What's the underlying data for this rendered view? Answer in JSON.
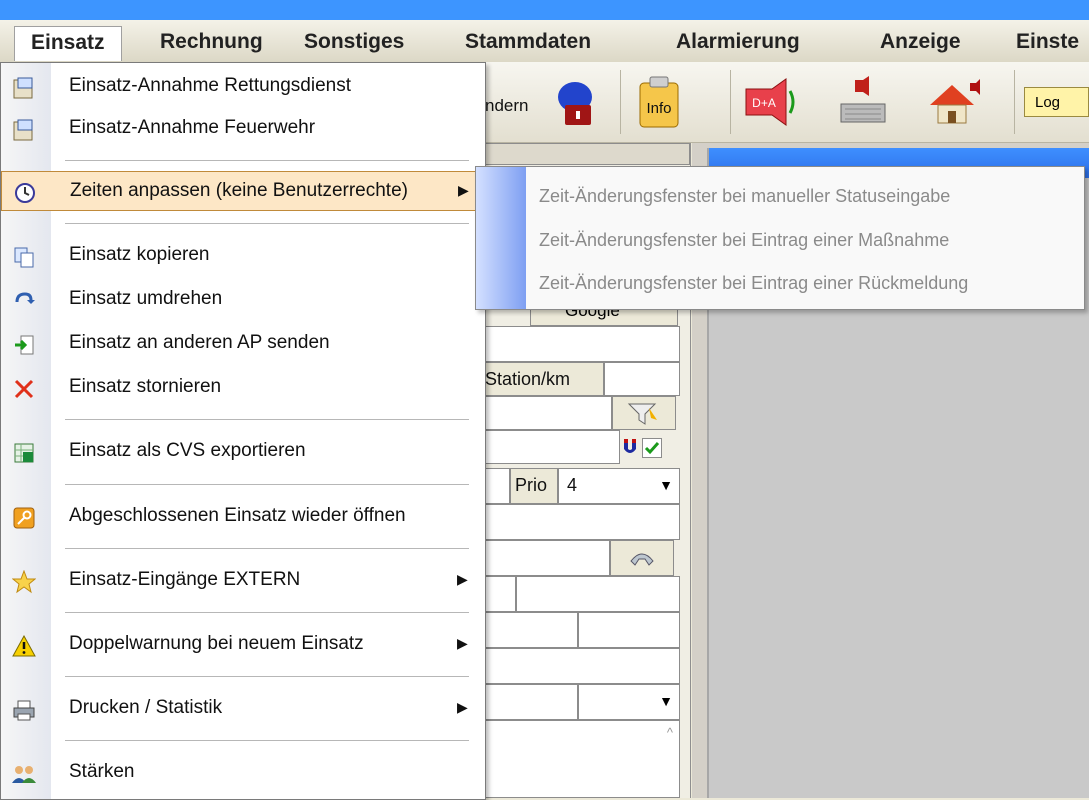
{
  "menubar": {
    "items": [
      "Einsatz",
      "Rechnung",
      "Sonstiges",
      "Stammdaten",
      "Alarmierung",
      "Anzeige",
      "Einste"
    ]
  },
  "toolbar": {
    "partial_label": "ndern",
    "info_label": "Info",
    "da_label": "D+A",
    "log_label": "Log"
  },
  "menu": {
    "items": [
      {
        "label": "Einsatz-Annahme Rettungsdienst",
        "icon": "form-icon"
      },
      {
        "label": "Einsatz-Annahme Feuerwehr",
        "icon": "form-icon"
      },
      {
        "label": "Zeiten anpassen (keine Benutzerrechte)",
        "icon": "clock-icon",
        "submenu": true,
        "highlighted": true
      },
      {
        "label": "Einsatz kopieren",
        "icon": "copy-icon"
      },
      {
        "label": "Einsatz umdrehen",
        "icon": "turn-icon"
      },
      {
        "label": "Einsatz an anderen AP senden",
        "icon": "send-icon"
      },
      {
        "label": "Einsatz stornieren",
        "icon": "cancel-x-icon"
      },
      {
        "label": "Einsatz als CVS exportieren",
        "icon": "excel-icon"
      },
      {
        "label": "Abgeschlossenen Einsatz wieder öffnen",
        "icon": "key-icon"
      },
      {
        "label": "Einsatz-Eingänge EXTERN",
        "icon": "star-icon",
        "submenu": true
      },
      {
        "label": "Doppelwarnung bei neuem Einsatz",
        "icon": "warning-icon",
        "submenu": true
      },
      {
        "label": "Drucken / Statistik",
        "icon": "printer-icon",
        "submenu": true
      },
      {
        "label": "Stärken",
        "icon": "users-icon"
      }
    ]
  },
  "submenu": {
    "items": [
      "Zeit-Änderungsfenster bei manueller Statuseingabe",
      "Zeit-Änderungsfenster bei Eintrag einer Maßnahme",
      "Zeit-Änderungsfenster bei Eintrag einer Rückmeldung"
    ]
  },
  "form": {
    "google_label": "Google",
    "station_label": "Station/km",
    "prio_label": "Prio",
    "prio_value": "4"
  }
}
